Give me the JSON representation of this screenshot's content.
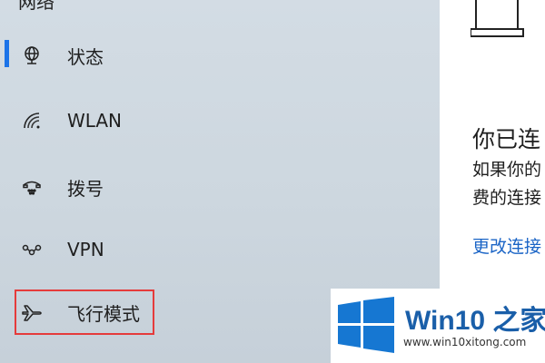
{
  "sidebar": {
    "title": "网络",
    "items": [
      {
        "label": "状态",
        "icon": "globe-icon"
      },
      {
        "label": "WLAN",
        "icon": "wifi-icon"
      },
      {
        "label": "拨号",
        "icon": "dialup-icon"
      },
      {
        "label": "VPN",
        "icon": "vpn-icon"
      },
      {
        "label": "飞行模式",
        "icon": "airplane-icon"
      }
    ]
  },
  "main": {
    "title": "你已连",
    "description_line1": "如果你的",
    "description_line2": "费的连接",
    "change_link": "更改连接"
  },
  "watermark": {
    "brand": "Win10 之家",
    "url": "www.win10xitong.com"
  },
  "colors": {
    "accent": "#1b73e8",
    "highlight": "#e53b3b",
    "link": "#1a64c6"
  }
}
